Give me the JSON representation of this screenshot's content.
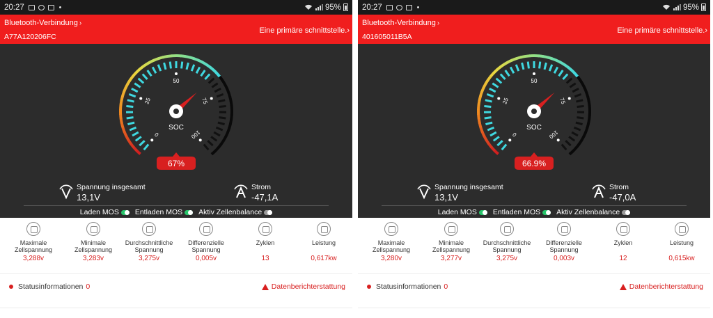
{
  "status_bar": {
    "left": {
      "time": "20:27",
      "battery": "95%"
    },
    "right": {
      "time": "20:27",
      "battery": "95%"
    }
  },
  "devices": [
    {
      "bluetooth_label": "Bluetooth-Verbindung",
      "device_id": "A77A120206FC",
      "interface_link": "Eine primäre schnittstelle.",
      "soc_label": "SOC",
      "soc_percent": 67,
      "soc_text": "67%",
      "gauge_ticks": [
        "0",
        "25",
        "50",
        "75",
        "100"
      ],
      "voltage_label": "Spannung insgesamt",
      "voltage_value": "13,1V",
      "current_label": "Strom",
      "current_value": "-47,1A",
      "toggles": [
        {
          "label": "Laden MOS",
          "state": "on"
        },
        {
          "label": "Entladen MOS",
          "state": "on"
        },
        {
          "label": "Aktiv Zellenbalance",
          "state": "off"
        }
      ],
      "metrics": [
        {
          "label": "Maximale\nZellspannung",
          "value": "3,288v"
        },
        {
          "label": "Minimale\nZellspannung",
          "value": "3,283v"
        },
        {
          "label": "Durchschnittliche\nSpannung",
          "value": "3,275v"
        },
        {
          "label": "Differenzielle\nSpannung",
          "value": "0,005v"
        },
        {
          "label": "Zyklen",
          "value": "13"
        },
        {
          "label": "Leistung",
          "value": "0,617kw"
        }
      ],
      "status_info_label": "Statusinformationen",
      "status_info_count": "0",
      "data_report_label": "Datenberichterstattung"
    },
    {
      "bluetooth_label": "Bluetooth-Verbindung",
      "device_id": "401605011B5A",
      "interface_link": "Eine primäre schnittstelle.",
      "soc_label": "SOC",
      "soc_percent": 66.9,
      "soc_text": "66.9%",
      "gauge_ticks": [
        "0",
        "25",
        "50",
        "75",
        "100"
      ],
      "voltage_label": "Spannung insgesamt",
      "voltage_value": "13,1V",
      "current_label": "Strom",
      "current_value": "-47,0A",
      "toggles": [
        {
          "label": "Laden MOS",
          "state": "on"
        },
        {
          "label": "Entladen MOS",
          "state": "on"
        },
        {
          "label": "Aktiv Zellenbalance",
          "state": "off"
        }
      ],
      "metrics": [
        {
          "label": "Maximale\nZellspannung",
          "value": "3,280v"
        },
        {
          "label": "Minimale\nZellspannung",
          "value": "3,277v"
        },
        {
          "label": "Durchschnittliche\nSpannung",
          "value": "3,275v"
        },
        {
          "label": "Differenzielle\nSpannung",
          "value": "0,003v"
        },
        {
          "label": "Zyklen",
          "value": "12"
        },
        {
          "label": "Leistung",
          "value": "0,615kw"
        }
      ],
      "status_info_label": "Statusinformationen",
      "status_info_count": "0",
      "data_report_label": "Datenberichterstattung"
    }
  ],
  "colors": {
    "header_red": "#f01e1e",
    "dark_panel": "#2c2c2c",
    "value_red": "#d82020",
    "toggle_on": "#27c46a",
    "gauge_ticks": "#3fd8e0"
  }
}
